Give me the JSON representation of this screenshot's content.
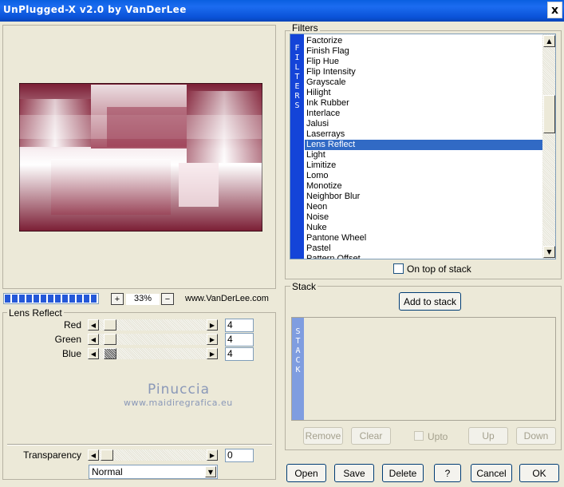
{
  "window": {
    "title": "UnPlugged-X v2.0 by VanDerLee",
    "close_glyph": "x"
  },
  "preview": {
    "zoom": "33%",
    "plus": "+",
    "minus": "−",
    "website": "www.VanDerLee.com"
  },
  "lens_reflect": {
    "group_label": "Lens Reflect",
    "sliders": [
      {
        "label": "Red",
        "value": "4"
      },
      {
        "label": "Green",
        "value": "4"
      },
      {
        "label": "Blue",
        "value": "4"
      }
    ]
  },
  "watermark": {
    "name": "Pinuccia",
    "url": "www.maidiregrafica.eu"
  },
  "transparency": {
    "label": "Transparency",
    "value": "0",
    "blend_mode": "Normal"
  },
  "filters": {
    "group_label": "Filters",
    "strip_letters": "F I L T E R S",
    "items": [
      "Factorize",
      "Finish Flag",
      "Flip Hue",
      "Flip Intensity",
      "Grayscale",
      "Hilight",
      "Ink Rubber",
      "Interlace",
      "Jalusi",
      "Laserrays",
      "Lens Reflect",
      "Light",
      "Limitize",
      "Lomo",
      "Monotize",
      "Neighbor Blur",
      "Neon",
      "Noise",
      "Nuke",
      "Pantone Wheel",
      "Pastel",
      "Pattern Offset"
    ],
    "selected": "Lens Reflect",
    "on_top_label": "On top of stack"
  },
  "stack": {
    "group_label": "Stack",
    "add_label": "Add to stack",
    "strip_letters": "S T A C K",
    "remove_label": "Remove",
    "clear_label": "Clear",
    "upto_label": "Upto",
    "up_label": "Up",
    "down_label": "Down"
  },
  "footer": {
    "open": "Open",
    "save": "Save",
    "delete": "Delete",
    "help": "?",
    "cancel": "Cancel",
    "ok": "OK"
  },
  "colors": {
    "title_bar": "#0a52d8",
    "selection": "#316ac5",
    "strip": "#1444d8",
    "stack_strip": "#7f9de0"
  }
}
